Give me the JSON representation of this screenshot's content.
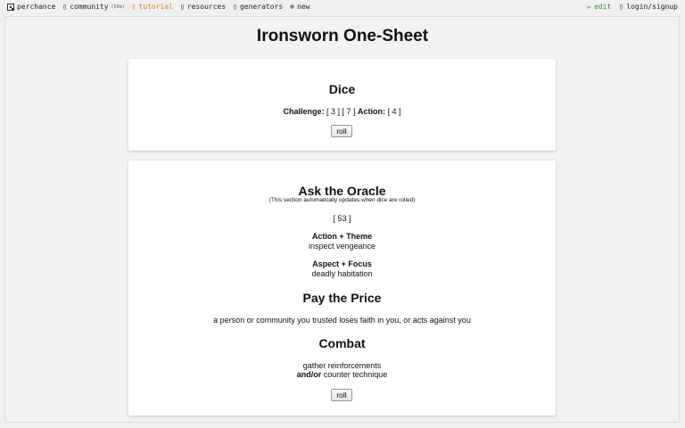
{
  "nav": {
    "logo_icon": "dice-icon",
    "site": "perchance",
    "community": "community",
    "community_count": "(50m)",
    "tutorial": "tutorial",
    "resources": "resources",
    "generators": "generators",
    "new": "new",
    "edit": "edit",
    "login": "login/signup"
  },
  "page_title": "Ironsworn One-Sheet",
  "dice": {
    "heading": "Dice",
    "challenge_label": "Challenge:",
    "challenge_values": "[ 3 ] [ 7 ]",
    "action_label": "Action:",
    "action_value": "[ 4 ]",
    "roll_label": "roll"
  },
  "oracle": {
    "heading": "Ask the Oracle",
    "note": "(This section automatically updates when dice are rolled)",
    "value": "[ 53 ]",
    "action_theme_label": "Action + Theme",
    "action_theme_value": "inspect vengeance",
    "aspect_focus_label": "Aspect + Focus",
    "aspect_focus_value": "deadly habitation"
  },
  "price": {
    "heading": "Pay the Price",
    "text": "a person or community you trusted loses faith in you, or acts against you"
  },
  "combat": {
    "heading": "Combat",
    "line1": "gather reinforcements",
    "andor": "and/or",
    "line2": "counter technique",
    "roll_label": "roll"
  },
  "colors": {
    "tutorial": "#e07a1f",
    "edit": "#2d8a2d",
    "background": "#f0f0f0"
  }
}
